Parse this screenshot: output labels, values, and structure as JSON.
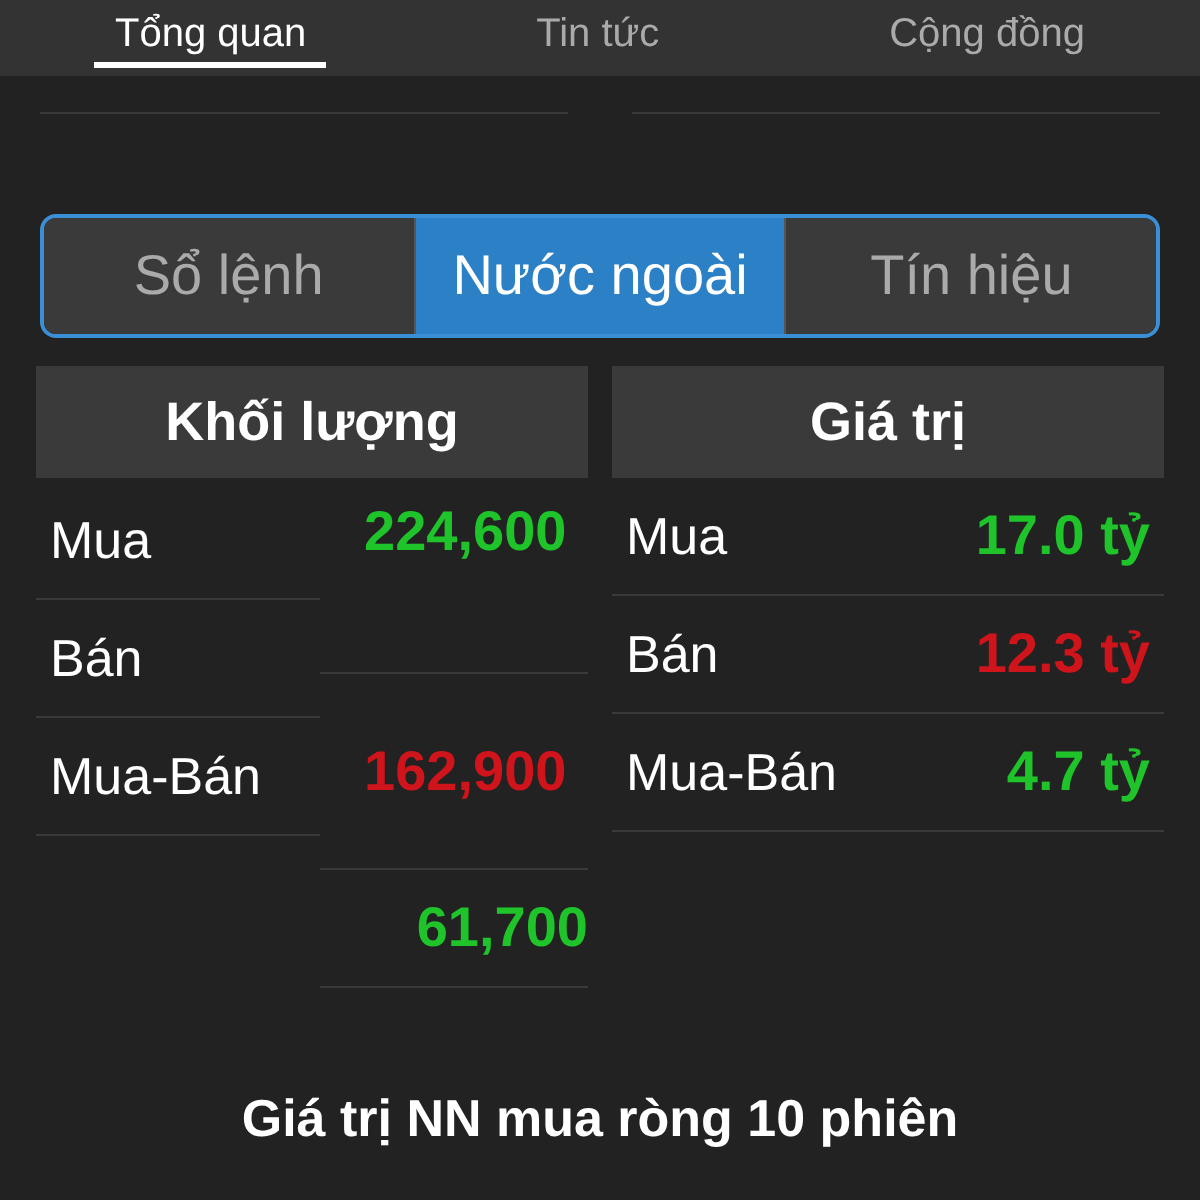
{
  "top_tabs": [
    {
      "label": "Tổng quan",
      "selected": true
    },
    {
      "label": "Tin tức",
      "selected": false
    },
    {
      "label": "Cộng đồng",
      "selected": false
    }
  ],
  "segments": [
    {
      "label": "Sổ lệnh",
      "selected": false
    },
    {
      "label": "Nước ngoài",
      "selected": true
    },
    {
      "label": "Tín hiệu",
      "selected": false
    }
  ],
  "volume": {
    "title": "Khối lượng",
    "labels": [
      "Mua",
      "Bán",
      "Mua-Bán"
    ],
    "values": [
      {
        "text": "224,600",
        "color": "#1fc42a"
      },
      {
        "text": "162,900",
        "color": "#d0141b"
      },
      {
        "text": "61,700",
        "color": "#1fc42a"
      }
    ]
  },
  "value": {
    "title": "Giá trị",
    "rows": [
      {
        "label": "Mua",
        "value": "17.0 tỷ",
        "color": "#1fc42a"
      },
      {
        "label": "Bán",
        "value": "12.3 tỷ",
        "color": "#d0141b"
      },
      {
        "label": "Mua-Bán",
        "value": "4.7 tỷ",
        "color": "#1fc42a"
      }
    ]
  },
  "footer_title": "Giá trị NN mua ròng 10 phiên"
}
